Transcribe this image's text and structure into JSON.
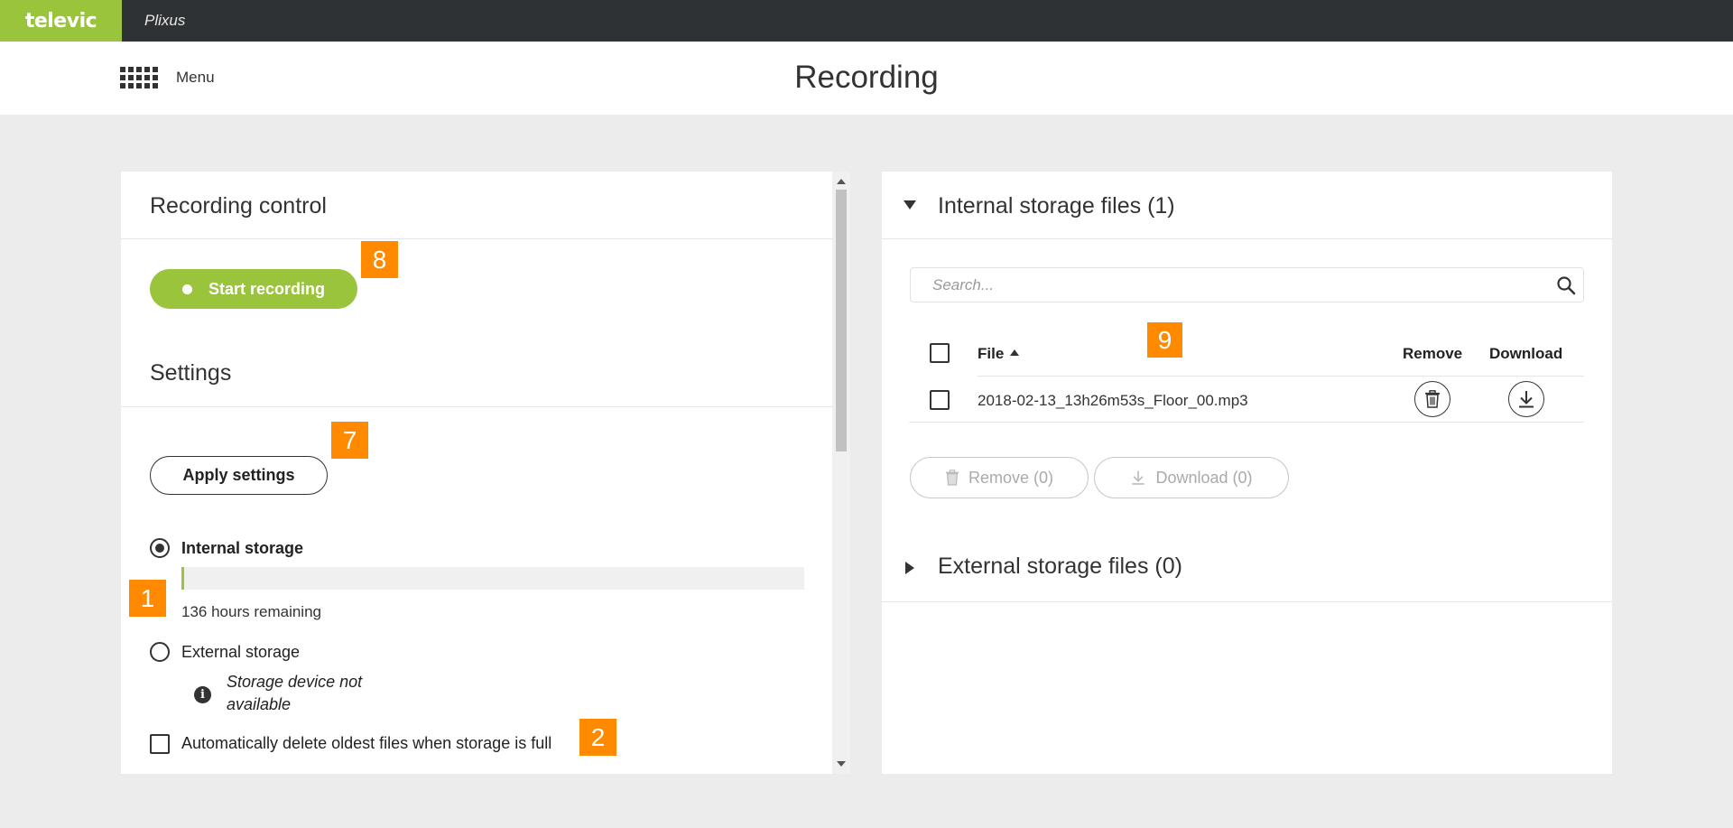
{
  "topbar": {
    "brand": "televic",
    "app_name": "Plixus"
  },
  "header": {
    "menu_label": "Menu",
    "page_title": "Recording"
  },
  "recording_control": {
    "title": "Recording control",
    "start_label": "Start recording"
  },
  "settings": {
    "title": "Settings",
    "apply_label": "Apply settings",
    "internal_storage": {
      "label": "Internal storage",
      "selected": true,
      "usage_fraction": 0.005,
      "remaining_text": "136 hours remaining"
    },
    "external_storage": {
      "label": "External storage",
      "selected": false,
      "info_text": "Storage device not available"
    },
    "auto_delete": {
      "label": "Automatically delete oldest files when storage is full",
      "checked": false
    }
  },
  "badges": {
    "b1": "1",
    "b2": "2",
    "b7": "7",
    "b8": "8",
    "b9": "9"
  },
  "internal_files": {
    "title": "Internal storage files (1)",
    "expanded": true,
    "search_placeholder": "Search...",
    "columns": {
      "file": "File",
      "remove": "Remove",
      "download": "Download"
    },
    "sort": "ascending",
    "rows": [
      {
        "file": "2018-02-13_13h26m53s_Floor_00.mp3",
        "checked": false
      }
    ],
    "remove_selected_label": "Remove (0)",
    "download_selected_label": "Download (0)"
  },
  "external_files": {
    "title": "External storage files (0)",
    "expanded": false
  },
  "colors": {
    "brand_green": "#9ac43c",
    "badge_orange": "#ff8a00",
    "topbar": "#2f3234"
  },
  "icons": [
    "grid-icon",
    "search-icon",
    "trash-icon",
    "download-icon",
    "info-icon",
    "triangle-down-icon",
    "triangle-right-icon",
    "sort-asc-icon"
  ]
}
